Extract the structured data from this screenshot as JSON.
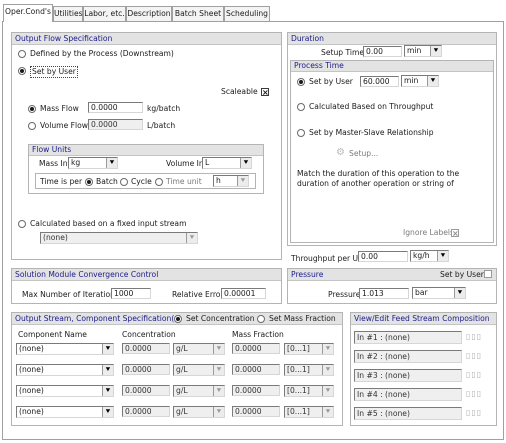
{
  "tabs": [
    "Oper.Cond's",
    "Utilities",
    "Labor, etc.",
    "Description",
    "Batch Sheet",
    "Scheduling"
  ],
  "output_flow": {
    "title": "Output Flow Specification",
    "defined_by_process": "Defined by the Process (Downstream)",
    "set_by_user": "Set by User",
    "scaleable": "Scaleable",
    "mass_flow_label": "Mass Flow",
    "mass_flow_value": "0.0000",
    "mass_flow_unit": "kg/batch",
    "volume_flow_label": "Volume Flow",
    "volume_flow_value": "0.0000",
    "volume_flow_unit": "L/batch",
    "flow_units_title": "Flow Units",
    "mass_in_label": "Mass In",
    "mass_in_value": "kg",
    "volume_in_label": "Volume In",
    "volume_in_value": "L",
    "time_is_per_label": "Time is per",
    "batch": "Batch",
    "cycle": "Cycle",
    "time_unit_label": "Time unit",
    "time_unit_value": "h",
    "fixed_input_label": "Calculated based on a fixed input stream",
    "fixed_input_value": "(none)"
  },
  "duration": {
    "title": "Duration",
    "setup_time_label": "Setup Time",
    "setup_time_value": "0.00",
    "setup_time_unit": "min",
    "process_time_title": "Process Time",
    "set_by_user": "Set by User",
    "process_time_value": "60.000",
    "process_time_unit": "min",
    "calc_throughput": "Calculated Based on Throughput",
    "master_slave": "Set by Master-Slave Relationship",
    "setup_button": "Setup...",
    "match_text": "Match the duration of this operation to the duration of another operation or string of",
    "ignore_label": "Ignore Labels",
    "throughput_label": "Throughput per Unit",
    "throughput_value": "0.00",
    "throughput_unit": "kg/h"
  },
  "solution": {
    "title": "Solution Module Convergence Control",
    "max_iter_label": "Max Number of Iterations",
    "max_iter_value": "1000",
    "rel_error_label": "Relative Error",
    "rel_error_value": "0.00001"
  },
  "pressure": {
    "title": "Pressure",
    "set_by_user": "Set by User",
    "label": "Pressure",
    "value": "1.013",
    "unit": "bar"
  },
  "output_stream": {
    "title": "Output Stream, Component Specification(s)",
    "set_concentration": "Set Concentration",
    "set_mass_fraction": "Set Mass Fraction",
    "col_component": "Component Name",
    "col_concentration": "Concentration",
    "col_mass_fraction": "Mass Fraction",
    "rows": [
      {
        "component": "(none)",
        "conc": "0.0000",
        "conc_unit": "g/L",
        "frac": "0.0000",
        "range": "[0...1]"
      },
      {
        "component": "(none)",
        "conc": "0.0000",
        "conc_unit": "g/L",
        "frac": "0.0000",
        "range": "[0...1]"
      },
      {
        "component": "(none)",
        "conc": "0.0000",
        "conc_unit": "g/L",
        "frac": "0.0000",
        "range": "[0...1]"
      },
      {
        "component": "(none)",
        "conc": "0.0000",
        "conc_unit": "g/L",
        "frac": "0.0000",
        "range": "[0...1]"
      }
    ]
  },
  "feed": {
    "title": "View/Edit Feed Stream Composition",
    "rows": [
      "In #1 : (none)",
      "In #2 : (none)",
      "In #3 : (none)",
      "In #4 : (none)",
      "In #5 : (none)"
    ]
  },
  "icons": {
    "dropdown": "arrow-down-icon",
    "setup": "gear-icon",
    "feed_edit": "component-bars-icon"
  }
}
